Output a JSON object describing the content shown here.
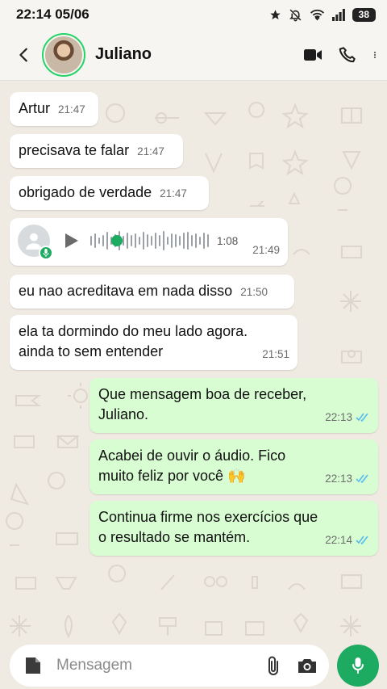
{
  "status_bar": {
    "time": "22:14 05/06",
    "battery": "38"
  },
  "header": {
    "contact_name": "Juliano"
  },
  "messages": [
    {
      "direction": "in",
      "text": "Artur",
      "time": "21:47"
    },
    {
      "direction": "in",
      "text": "precisava te falar",
      "time": "21:47"
    },
    {
      "direction": "in",
      "text": "obrigado de verdade",
      "time": "21:47"
    },
    {
      "direction": "in",
      "type": "audio",
      "duration": "1:08",
      "time": "21:49"
    },
    {
      "direction": "in",
      "text": "eu nao acreditava em nada disso",
      "time": "21:50"
    },
    {
      "direction": "in",
      "text": "ela ta dormindo do meu lado agora. ainda to sem entender",
      "time": "21:51"
    },
    {
      "direction": "out",
      "text": "Que mensagem boa de receber, Juliano.",
      "time": "22:13",
      "status": "read"
    },
    {
      "direction": "out",
      "text": "Acabei de ouvir o áudio. Fico muito feliz por você 🙌",
      "time": "22:13",
      "status": "read"
    },
    {
      "direction": "out",
      "text": "Continua firme nos exercícios que o resultado se mantém.",
      "time": "22:14",
      "status": "read"
    }
  ],
  "composer": {
    "placeholder": "Mensagem"
  },
  "colors": {
    "accent": "#1daa61",
    "outgoing_bubble": "#d9fdd3",
    "read_ticks": "#53bdeb",
    "chat_bg": "#efeae2"
  },
  "icons": [
    "star-icon",
    "mute-icon",
    "wifi-icon",
    "signal-icon",
    "back-arrow-icon",
    "video-call-icon",
    "phone-icon",
    "more-options-icon",
    "play-icon",
    "mic-icon",
    "sticker-icon",
    "attach-icon",
    "camera-icon"
  ]
}
